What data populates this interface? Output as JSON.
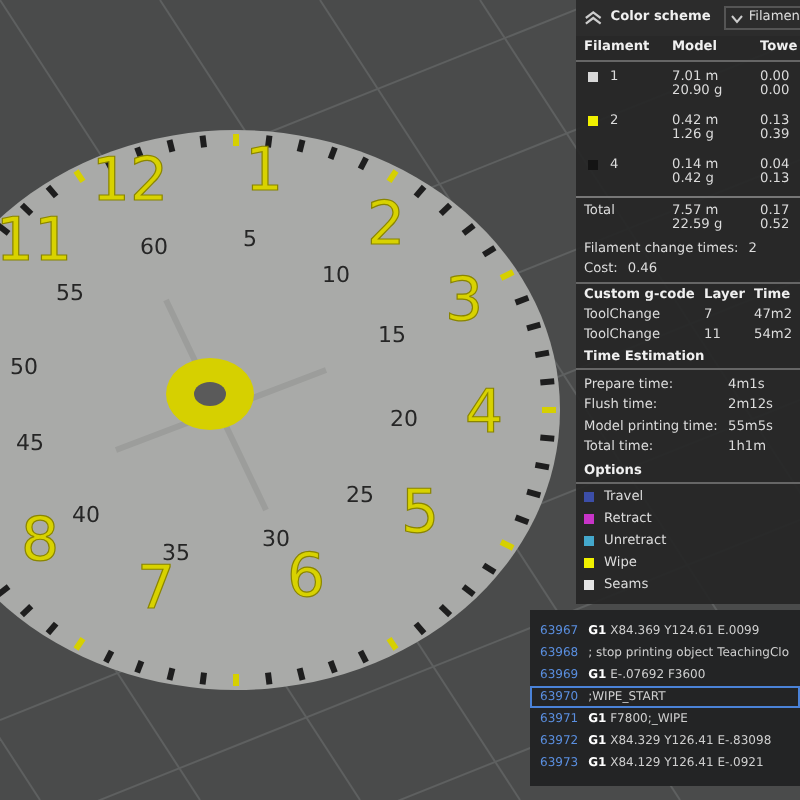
{
  "viewport": {
    "dial": {
      "hours": [
        "12",
        "1",
        "2",
        "3",
        "4",
        "5",
        "6",
        "7",
        "8",
        "11"
      ],
      "minutes": [
        "60",
        "5",
        "10",
        "15",
        "20",
        "25",
        "30",
        "35",
        "40",
        "45",
        "50",
        "55"
      ]
    }
  },
  "panel": {
    "title": "Color scheme",
    "scheme_dropdown": "Filamen",
    "filament_table": {
      "columns": [
        "Filament",
        "Model",
        "Towe"
      ],
      "rows": [
        {
          "label": "1",
          "color": "#d8d8d8",
          "model": [
            "7.01 m",
            "20.90 g"
          ],
          "tower": [
            "0.00",
            "0.00"
          ]
        },
        {
          "label": "2",
          "color": "#f0f000",
          "model": [
            "0.42 m",
            "1.26 g"
          ],
          "tower": [
            "0.13",
            "0.39"
          ]
        },
        {
          "label": "4",
          "color": "#141414",
          "model": [
            "0.14 m",
            "0.42 g"
          ],
          "tower": [
            "0.04",
            "0.13"
          ]
        }
      ],
      "total": {
        "label": "Total",
        "model": [
          "7.57 m",
          "22.59 g"
        ],
        "tower": [
          "0.17",
          "0.52"
        ]
      }
    },
    "change_times": {
      "label": "Filament change times:",
      "value": "2"
    },
    "cost": {
      "label": "Cost:",
      "value": "0.46"
    },
    "custom_gcode": {
      "columns": [
        "Custom g-code",
        "Layer",
        "Time"
      ],
      "rows": [
        {
          "name": "ToolChange",
          "layer": "7",
          "time": "47m2"
        },
        {
          "name": "ToolChange",
          "layer": "11",
          "time": "54m2"
        }
      ]
    },
    "time_estimation": {
      "title": "Time Estimation",
      "rows": [
        {
          "label": "Prepare time:",
          "value": "4m1s"
        },
        {
          "label": "Flush time:",
          "value": "2m12s"
        },
        {
          "label": "Model printing time:",
          "value": "55m5s"
        },
        {
          "label": "Total time:",
          "value": "1h1m"
        }
      ]
    },
    "options": {
      "title": "Options",
      "items": [
        {
          "label": "Travel",
          "color": "#3c4ea8"
        },
        {
          "label": "Retract",
          "color": "#c834c8"
        },
        {
          "label": "Unretract",
          "color": "#44a8cc"
        },
        {
          "label": "Wipe",
          "color": "#f0f000"
        },
        {
          "label": "Seams",
          "color": "#e4e4e4"
        }
      ]
    }
  },
  "gcode": {
    "lines": [
      {
        "number": "63967",
        "text": "**G1** X84.369 Y124.61 E.0099",
        "selected": false
      },
      {
        "number": "63968",
        "text": "; stop printing object TeachingClo",
        "selected": false
      },
      {
        "number": "63969",
        "text": "**G1** E-.07692 F3600",
        "selected": false
      },
      {
        "number": "63970",
        "text": ";WIPE_START",
        "selected": true
      },
      {
        "number": "63971",
        "text": "**G1** F7800;_WIPE",
        "selected": false
      },
      {
        "number": "63972",
        "text": "**G1** X84.329 Y126.41 E-.83098",
        "selected": false
      },
      {
        "number": "63973",
        "text": "**G1** X84.129 Y126.41 E-.0921",
        "selected": false
      }
    ]
  }
}
